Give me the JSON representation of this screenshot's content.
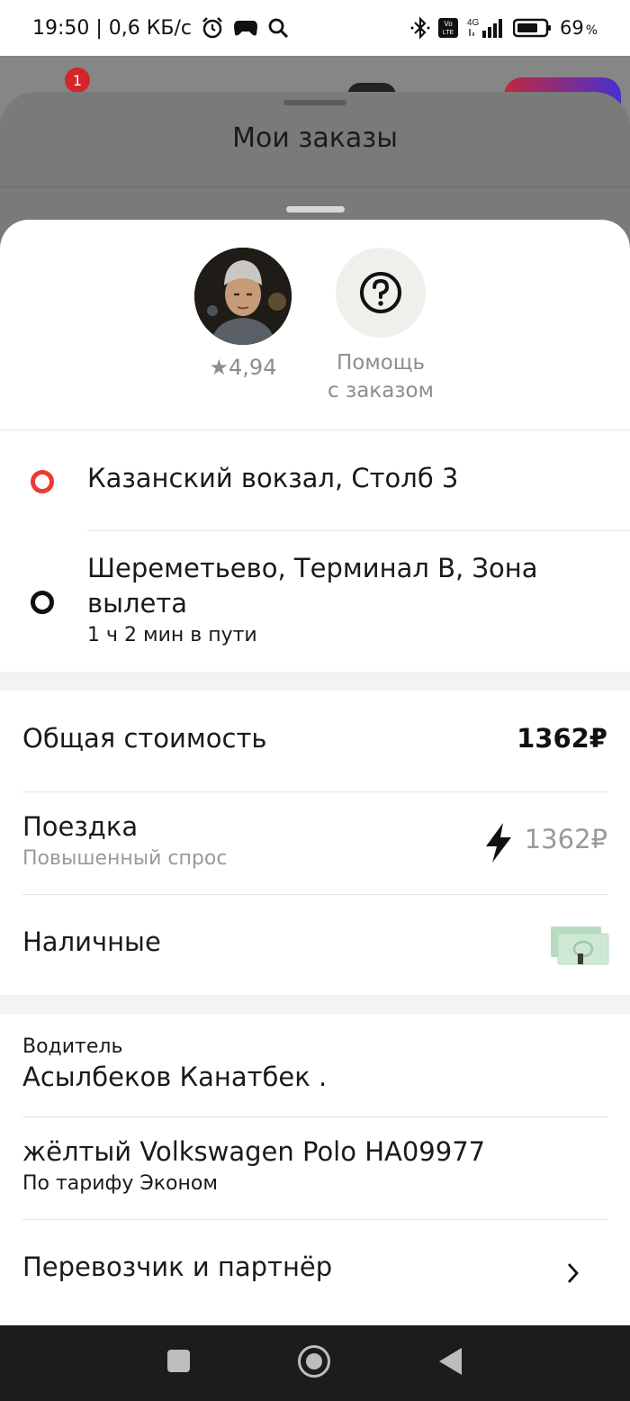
{
  "status_bar": {
    "time_speed": "19:50 | 0,6 КБ/с",
    "battery_percent": "69",
    "percent_sign": "%",
    "network": "4G",
    "volte": "Vo LTE"
  },
  "background": {
    "badge_count": "1"
  },
  "sheet": {
    "title": "Мои заказы"
  },
  "driver_card": {
    "rating": "★4,94",
    "help_line1": "Помощь",
    "help_line2": "с заказом"
  },
  "route": {
    "from": "Казанский вокзал, Столб 3",
    "to_line1": "Шереметьево, Терминал В, Зона",
    "to_line2": "вылета",
    "duration": "1 ч 2 мин в пути"
  },
  "cost": {
    "total_label": "Общая стоимость",
    "total_value": "1362₽",
    "trip_label": "Поездка",
    "trip_sub": "Повышенный спрос",
    "trip_value": "1362₽",
    "payment_label": "Наличные"
  },
  "driver": {
    "caption": "Водитель",
    "name": "Асылбеков Канатбек .",
    "car": "жёлтый Volkswagen Polo НА09977",
    "tariff": "По тарифу Эконом",
    "carrier": "Перевозчик и партнёр"
  },
  "colors": {
    "origin_dot": "#ee3b32",
    "destination_dot": "#111111",
    "muted_text": "#8d8d8d",
    "surge_icon": "#111111",
    "cash_icon": "#b7dcc0"
  }
}
